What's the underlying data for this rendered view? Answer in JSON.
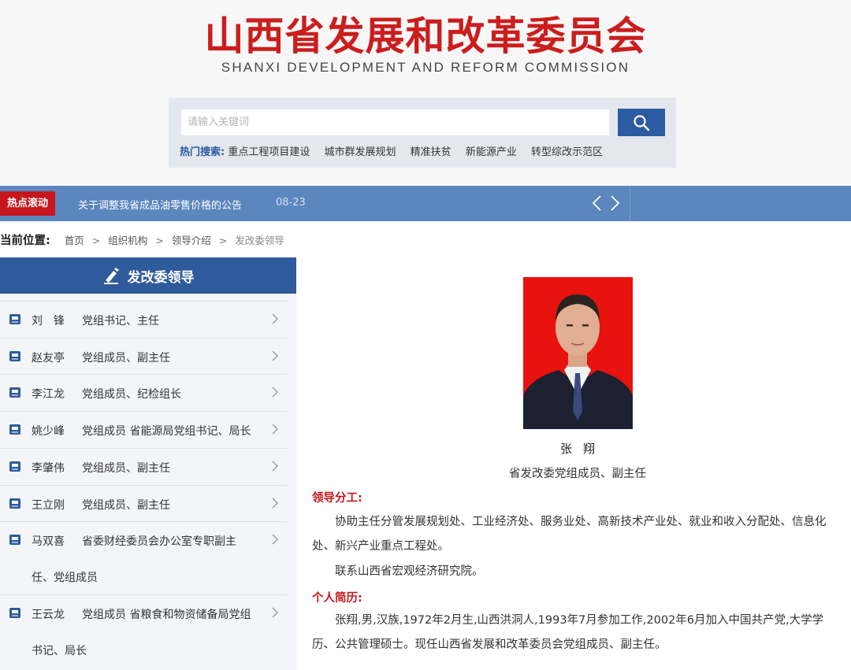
{
  "header": {
    "title": "山西省发展和改革委员会",
    "subtitle": "SHANXI DEVELOPMENT AND REFORM COMMISSION"
  },
  "search": {
    "placeholder": "请输入关键词",
    "value": "",
    "hot_label": "热门搜索:",
    "hot_items": [
      "重点工程项目建设",
      "城市群发展规划",
      "精准扶贫",
      "新能源产业",
      "转型综改示范区"
    ]
  },
  "ticker": {
    "label": "热点滚动",
    "text": "关于调整我省成品油零售价格的公告",
    "date": "08-23"
  },
  "breadcrumb": {
    "title": "当前位置:",
    "items": [
      "首页",
      "组织机构",
      "领导介绍",
      "发改委领导"
    ]
  },
  "sidebar": {
    "heading": "发改委领导",
    "items": [
      {
        "name": "刘　锋",
        "role": "党组书记、主任",
        "role2": ""
      },
      {
        "name": "赵友亭",
        "role": "党组成员、副主任",
        "role2": ""
      },
      {
        "name": "李江龙",
        "role": "党组成员、纪检组长",
        "role2": ""
      },
      {
        "name": "姚少峰",
        "role": "党组成员 省能源局党组书记、局长",
        "role2": ""
      },
      {
        "name": "李肇伟",
        "role": "党组成员、副主任",
        "role2": ""
      },
      {
        "name": "王立刚",
        "role": "党组成员、副主任",
        "role2": ""
      },
      {
        "name": "马双喜",
        "role": "省委财经委员会办公室专职副主",
        "role2": "任、党组成员"
      },
      {
        "name": "王云龙",
        "role": "党组成员 省粮食和物资储备局党组",
        "role2": "书记、局长"
      }
    ]
  },
  "profile": {
    "name": "张翔",
    "title": "省发改委党组成员、副主任",
    "duty_heading": "领导分工:",
    "duty_p1": "　　协助主任分管发展规划处、工业经济处、服务业处、高新技术产业处、就业和收入分配处、信息化处、新兴产业重点工程处。",
    "duty_p2": "　　联系山西省宏观经济研究院。",
    "bio_heading": "个人简历:",
    "bio_p1": "　　张翔,男,汉族,1972年2月生,山西洪洞人,1993年7月参加工作,2002年6月加入中国共产党,大学学历、公共管理硕士。现任山西省发展和改革委员会党组成员、副主任。"
  },
  "colors": {
    "brand_red": "#cc1d1d",
    "nav_blue": "#5b86be",
    "sidebar_blue": "#2f5a9c",
    "heading_red": "#c8161d"
  },
  "icons": [
    "search-icon",
    "chevron-left-icon",
    "chevron-right-icon",
    "pen-icon",
    "book-icon",
    "chevron-right-icon"
  ]
}
